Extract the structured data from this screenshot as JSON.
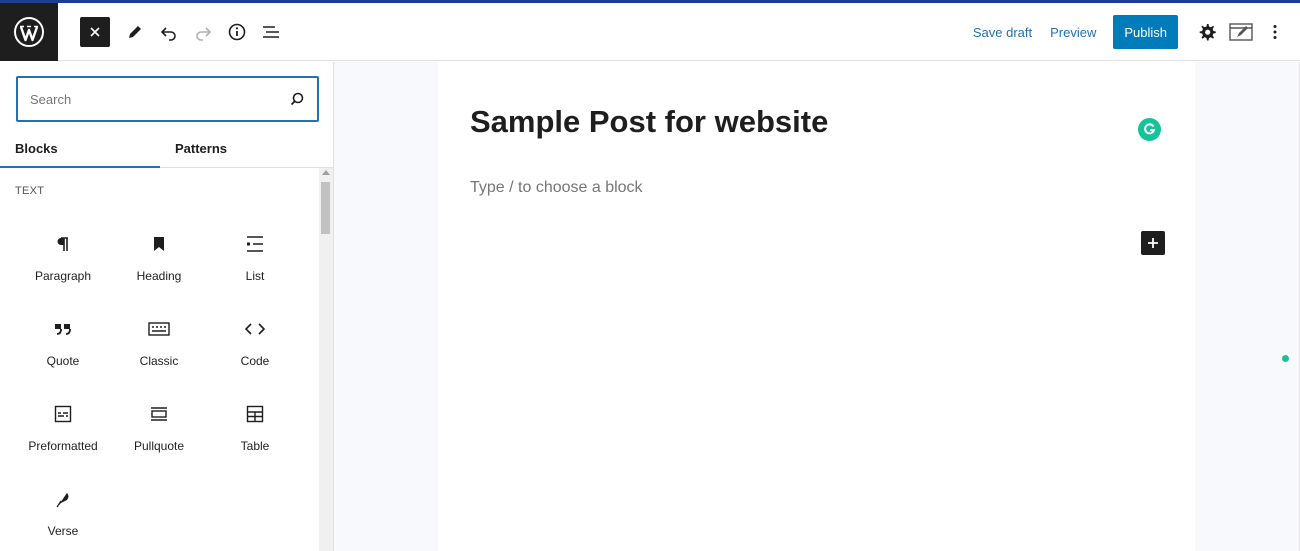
{
  "toolbar": {
    "save_draft": "Save draft",
    "preview": "Preview",
    "publish": "Publish"
  },
  "inserter": {
    "search_placeholder": "Search",
    "tabs": [
      {
        "label": "Blocks"
      },
      {
        "label": "Patterns"
      }
    ],
    "section_title": "TEXT",
    "blocks": [
      {
        "label": "Paragraph",
        "icon": "paragraph-icon"
      },
      {
        "label": "Heading",
        "icon": "bookmark-icon"
      },
      {
        "label": "List",
        "icon": "list-icon"
      },
      {
        "label": "Quote",
        "icon": "quote-icon"
      },
      {
        "label": "Classic",
        "icon": "keyboard-icon"
      },
      {
        "label": "Code",
        "icon": "code-icon"
      },
      {
        "label": "Preformatted",
        "icon": "preformatted-icon"
      },
      {
        "label": "Pullquote",
        "icon": "pullquote-icon"
      },
      {
        "label": "Table",
        "icon": "table-icon"
      },
      {
        "label": "Verse",
        "icon": "feather-icon"
      }
    ]
  },
  "editor": {
    "post_title": "Sample Post for website",
    "block_placeholder": "Type / to choose a block"
  },
  "colors": {
    "accent": "#2271b1",
    "publish": "#007cba",
    "grammarly": "#15c39a"
  }
}
